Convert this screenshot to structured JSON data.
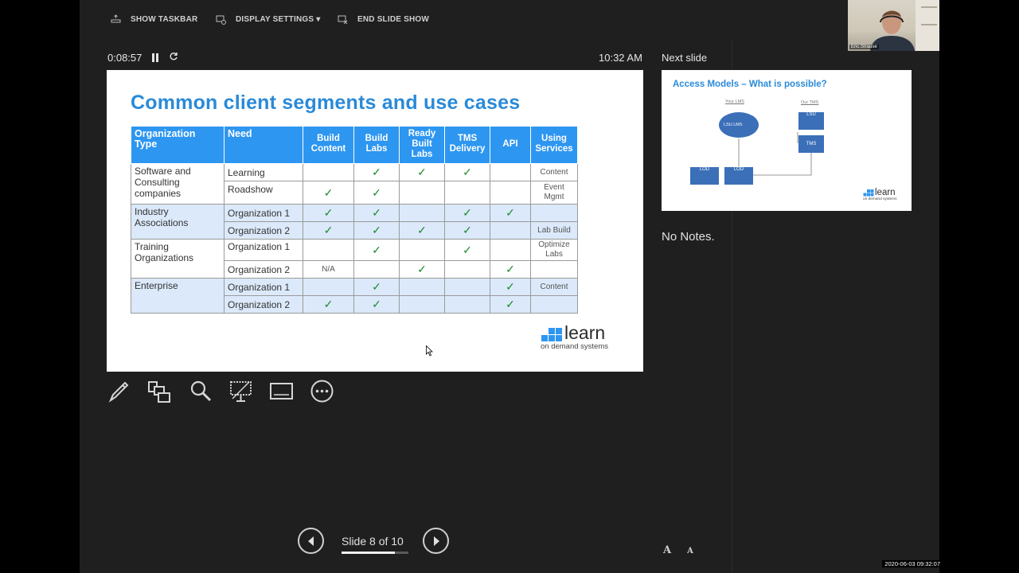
{
  "toolbar": {
    "show_taskbar": "SHOW TASKBAR",
    "display_settings": "DISPLAY SETTINGS ▾",
    "end_slide_show": "END SLIDE SHOW"
  },
  "timer": {
    "elapsed": "0:08:57",
    "clock": "10:32 AM"
  },
  "slide": {
    "title": "Common client segments and use cases",
    "table": {
      "headers": [
        "Organization Type",
        "Need",
        "Build Content",
        "Build Labs",
        "Ready Built Labs",
        "TMS Delivery",
        "API",
        "Using Services"
      ],
      "segments": {
        "software": "Software and Consulting companies",
        "industry": "Industry Associations",
        "training": "Training Organizations",
        "enterprise": "Enterprise"
      },
      "needs": {
        "learning": "Learning",
        "roadshow": "Roadshow",
        "org1": "Organization 1",
        "org2": "Organization 2"
      },
      "check": "✓",
      "na": "N/A",
      "services": {
        "content": "Content",
        "event": "Event Mgmt",
        "lab_build": "Lab Build",
        "optimize": "Optimize Labs"
      }
    },
    "logo": {
      "word": "learn",
      "sub": "on demand systems"
    }
  },
  "tools": [
    "pen-icon",
    "see-all-slides-icon",
    "zoom-icon",
    "black-screen-icon",
    "subtitles-icon",
    "more-options-icon"
  ],
  "navigation": {
    "slide_counter": "Slide 8 of 10",
    "current": 8,
    "total": 10,
    "progress_fraction": 0.8
  },
  "next_slide": {
    "label": "Next slide",
    "title": "Access Models – What is possible?",
    "labels": {
      "your_lms": "Your LMS",
      "our_tms": "Our TMS",
      "lsu_lms": "LSU LMS",
      "lsu": "LSU",
      "tms": "TMS",
      "lod_a": "LOD",
      "lod_b": "LOD"
    }
  },
  "notes": {
    "text": "No Notes."
  },
  "font_buttons": {
    "increase": "A",
    "decrease": "A"
  },
  "webcam": {
    "name": "Eric.Strause"
  },
  "timestamp": "2020-06-03  09:32:07",
  "colors": {
    "accent": "#2d96f0",
    "title": "#2a8ad8",
    "check": "#1c8a2e",
    "band": "#dbe9fa"
  }
}
